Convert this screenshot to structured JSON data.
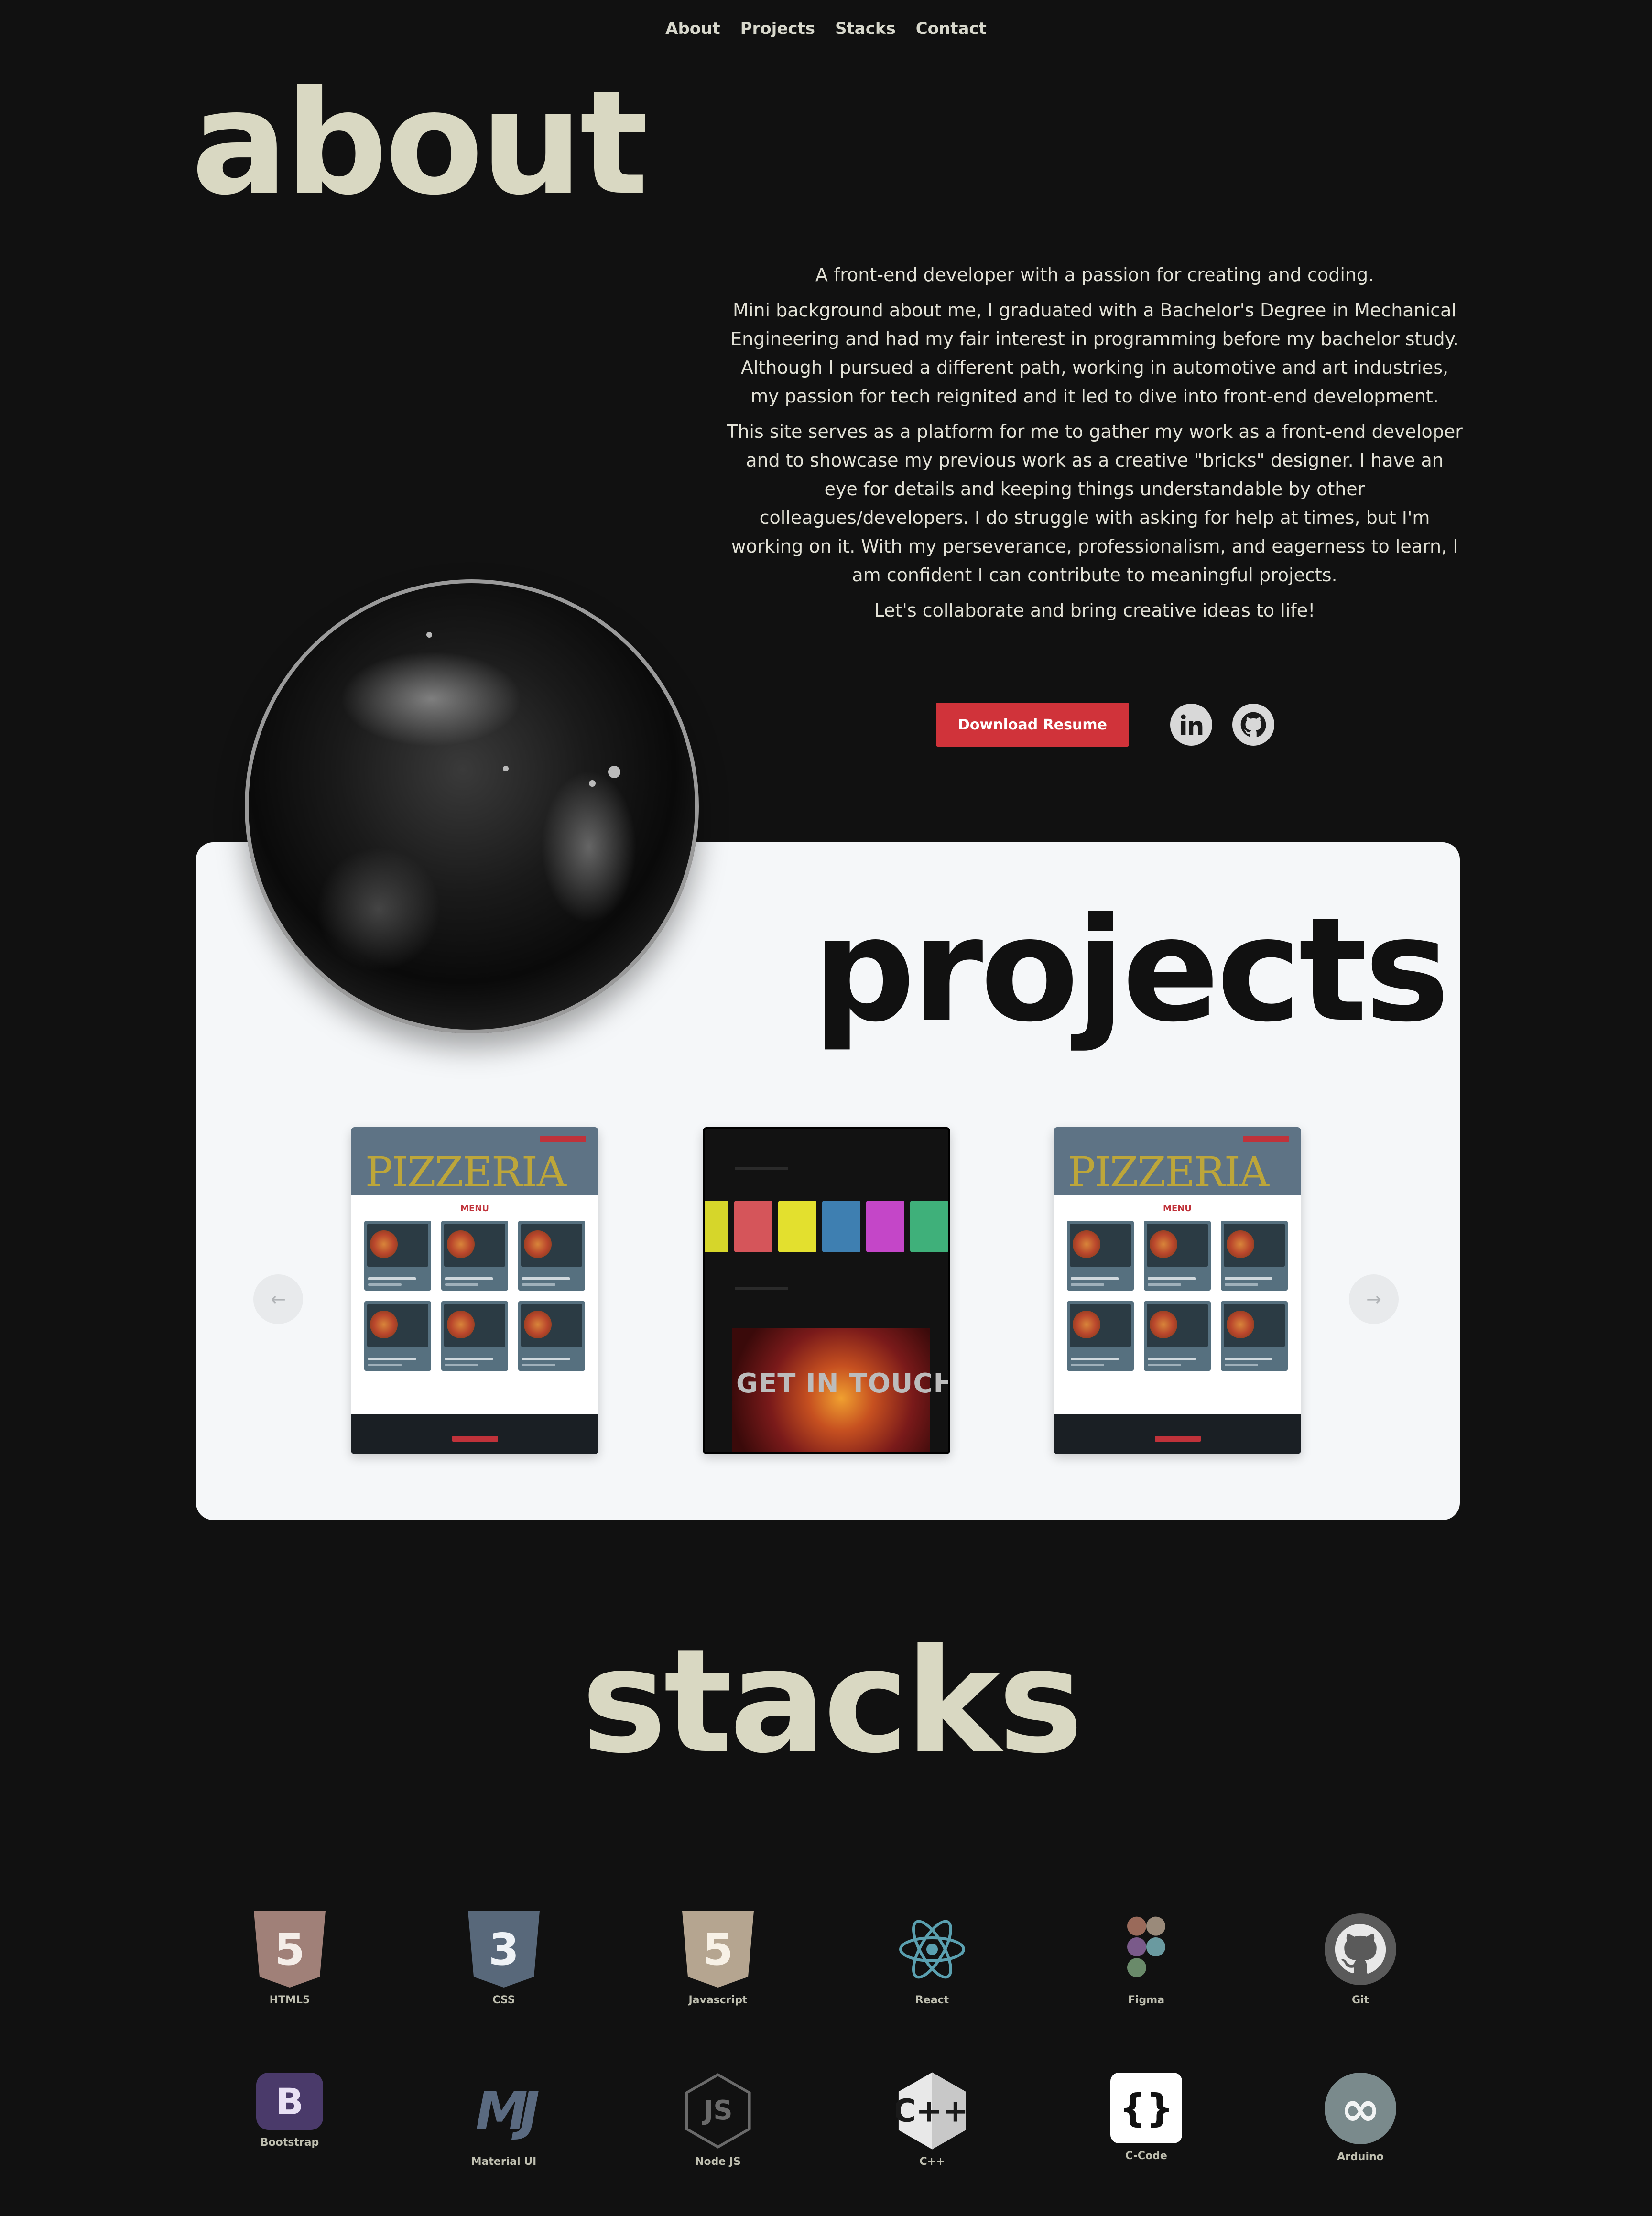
{
  "nav": [
    "About",
    "Projects",
    "Stacks",
    "Contact"
  ],
  "about": {
    "title": "about",
    "paragraphs": [
      "A front-end developer with a passion for creating and coding.",
      "Mini background about me, I graduated with a Bachelor's Degree in Mechanical Engineering and had my fair interest in programming before my bachelor study. Although I pursued a different path, working in automotive and art industries, my passion for tech reignited and it led to dive into front-end development.",
      "This site serves as a platform for me to gather my work as a front-end developer and to showcase my previous work as a creative \"bricks\" designer. I have an eye for details and keeping things understandable by other colleagues/developers. I do struggle with asking for help at times, but I'm working on it. With my perseverance, professionalism, and eagerness to learn, I am confident I can contribute to meaningful projects.",
      "Let's collaborate and bring creative ideas to life!"
    ],
    "resume_label": "Download Resume",
    "social": {
      "linkedin": "in",
      "github": "gh"
    }
  },
  "projects": {
    "title": "projects",
    "prev_arrow": "←",
    "next_arrow": "→",
    "thumbnails": [
      {
        "name": "pizzeria",
        "logo": "PIZZERIA",
        "menu": "MENU"
      },
      {
        "name": "portfolio",
        "cta": "GET IN TOUCH"
      },
      {
        "name": "pizzeria",
        "logo": "PIZZERIA",
        "menu": "MENU"
      }
    ]
  },
  "stacks": {
    "title": "stacks",
    "items": [
      {
        "label": "HTML5",
        "icon": "html5-icon",
        "glyph": "5",
        "color": "#a08078"
      },
      {
        "label": "CSS",
        "icon": "css3-icon",
        "glyph": "3",
        "color": "#58687a"
      },
      {
        "label": "Javascript",
        "icon": "javascript-icon",
        "glyph": "5",
        "color": "#b5a590"
      },
      {
        "label": "React",
        "icon": "react-icon",
        "glyph": "⚛",
        "color": "#5aa0b0"
      },
      {
        "label": "Figma",
        "icon": "figma-icon",
        "glyph": "●",
        "color": "#9a7aa0"
      },
      {
        "label": "Git",
        "icon": "github-icon",
        "glyph": "●",
        "color": "#5a5a5a"
      },
      {
        "label": "Bootstrap",
        "icon": "bootstrap-icon",
        "glyph": "B",
        "color": "#4a3a6a"
      },
      {
        "label": "Material UI",
        "icon": "material-ui-icon",
        "glyph": "MJ",
        "color": "#5a6a80"
      },
      {
        "label": "Node JS",
        "icon": "nodejs-icon",
        "glyph": "JS",
        "color": "#6a6a6a"
      },
      {
        "label": "C++",
        "icon": "cpp-icon",
        "glyph": "C++",
        "color": "#e0e0e0"
      },
      {
        "label": "C-Code",
        "icon": "c-code-icon",
        "glyph": "{}",
        "color": "#ffffff"
      },
      {
        "label": "Arduino",
        "icon": "arduino-icon",
        "glyph": "∞",
        "color": "#7a8a8c"
      }
    ]
  }
}
